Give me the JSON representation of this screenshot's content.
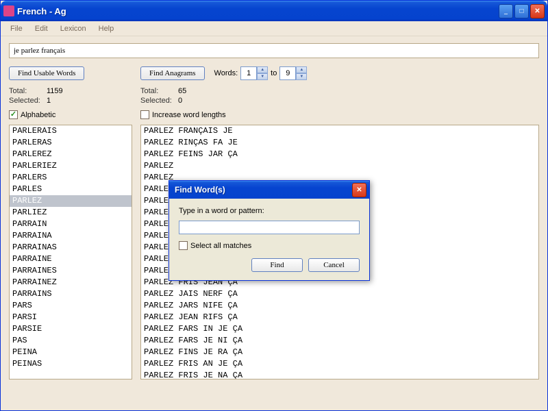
{
  "titlebar": {
    "text": "French - Ag"
  },
  "menu": {
    "file": "File",
    "edit": "Edit",
    "lexicon": "Lexicon",
    "help": "Help"
  },
  "input": {
    "value": "je parlez français"
  },
  "buttons": {
    "find_usable": "Find Usable Words",
    "find_anagrams": "Find Anagrams"
  },
  "spinner": {
    "words_label": "Words:",
    "from": "1",
    "to_label": "to",
    "to": "9"
  },
  "stats_left": {
    "total_label": "Total:",
    "total": "1159",
    "selected_label": "Selected:",
    "selected": "1"
  },
  "stats_right": {
    "total_label": "Total:",
    "total": "65",
    "selected_label": "Selected:",
    "selected": "0"
  },
  "check_left": {
    "label": "Alphabetic"
  },
  "check_right": {
    "label": "Increase word lengths"
  },
  "words": [
    "PARLERAIS",
    "PARLERAS",
    "PARLEREZ",
    "PARLERIEZ",
    "PARLERS",
    "PARLES",
    "PARLEZ",
    "PARLIEZ",
    "PARRAIN",
    "PARRAINA",
    "PARRAINAS",
    "PARRAINE",
    "PARRAINES",
    "PARRAINEZ",
    "PARRAINS",
    "PARS",
    "PARSI",
    "PARSIE",
    "PAS",
    "PEINA",
    "PEINAS"
  ],
  "selected_word_index": 6,
  "anagrams": [
    "PARLEZ FRANÇAIS JE",
    "PARLEZ RINÇAS FA JE",
    "PARLEZ FEINS JAR ÇA",
    "PARLEZ",
    "PARLEZ",
    "PARLEZ",
    "PARLEZ",
    "PARLEZ",
    "PARLEZ",
    "PARLEZ",
    "PARLEZ",
    "PARLEZ",
    "PARLEZ FINE JARS ÇA",
    "PARLEZ FRIS JEAN ÇA",
    "PARLEZ JAIS NERF ÇA",
    "PARLEZ JARS NIFE ÇA",
    "PARLEZ JEAN RIFS ÇA",
    "PARLEZ FARS IN JE ÇA",
    "PARLEZ FARS JE NI ÇA",
    "PARLEZ FINS JE RA ÇA",
    "PARLEZ FRIS AN JE ÇA",
    "PARLEZ FRIS JE NA ÇA"
  ],
  "dialog": {
    "title": "Find Word(s)",
    "label": "Type in a word or pattern:",
    "value": "",
    "check": "Select all matches",
    "find": "Find",
    "cancel": "Cancel"
  }
}
